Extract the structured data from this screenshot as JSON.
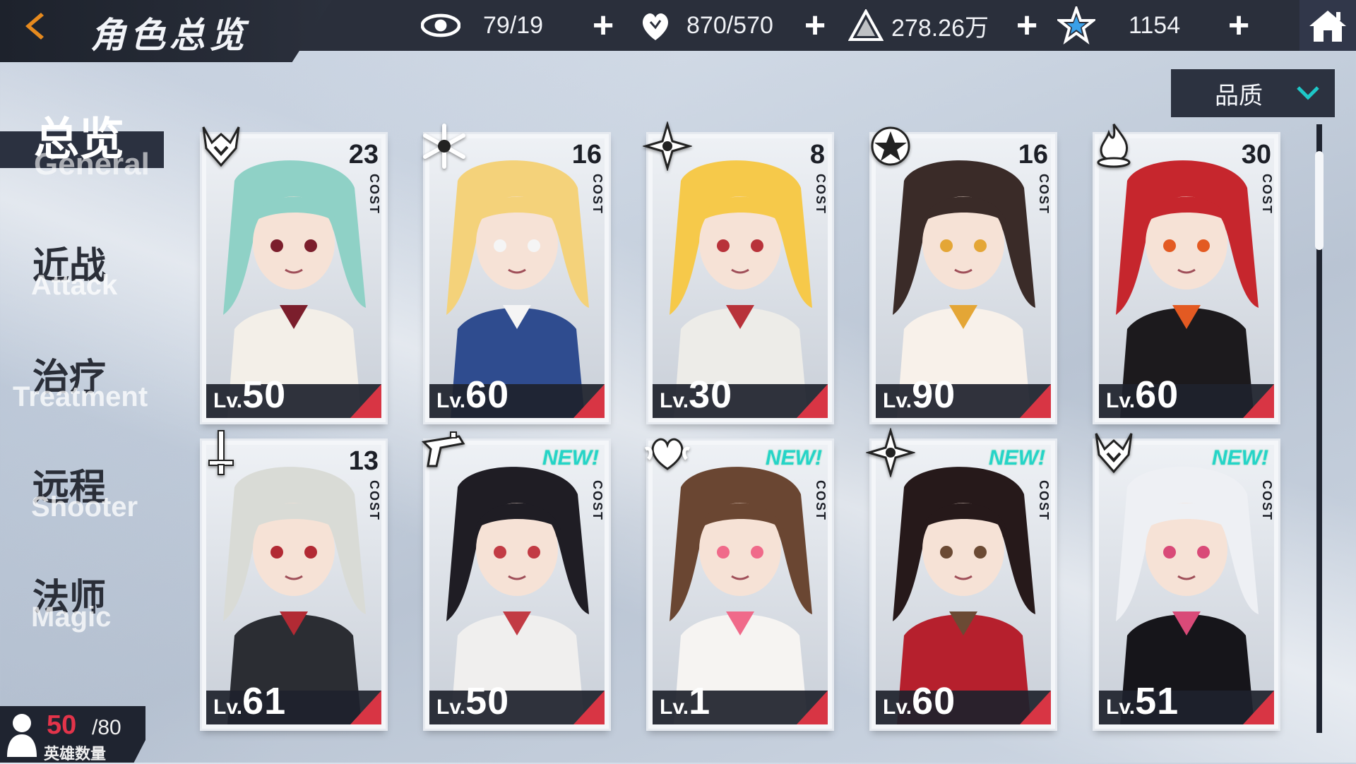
{
  "header": {
    "title": "角色总览",
    "back_icon": "back-arrow-icon",
    "resources": [
      {
        "name": "vision",
        "icon": "eye-icon",
        "value": "79/19"
      },
      {
        "name": "stamina",
        "icon": "heart-icon",
        "value": "870/570"
      },
      {
        "name": "gold",
        "icon": "pyramid-icon",
        "value": "278.26万"
      },
      {
        "name": "gems",
        "icon": "star-icon",
        "value": "1154"
      }
    ],
    "home_icon": "home-icon"
  },
  "sort": {
    "label": "品质"
  },
  "nav": [
    {
      "zh": "总览",
      "en": "General",
      "active": true
    },
    {
      "zh": "近战",
      "en": "Attack",
      "active": false
    },
    {
      "zh": "治疗",
      "en": "Treatment",
      "active": false
    },
    {
      "zh": "远程",
      "en": "Shooter",
      "active": false
    },
    {
      "zh": "法师",
      "en": "Magic",
      "active": false
    }
  ],
  "cards": [
    {
      "lv_prefix": "Lv.",
      "level": "50",
      "cost": "23",
      "cost_label": "COST",
      "new": "",
      "role_icon": "demon-icon",
      "palette": [
        "#8fd1c6",
        "#f3efe8",
        "#7b1e2c"
      ]
    },
    {
      "lv_prefix": "Lv.",
      "level": "60",
      "cost": "16",
      "cost_label": "COST",
      "new": "",
      "role_icon": "snowflake-icon",
      "palette": [
        "#f4d27a",
        "#2f4c8f",
        "#f5f5f5"
      ]
    },
    {
      "lv_prefix": "Lv.",
      "level": "30",
      "cost": "8",
      "cost_label": "COST",
      "new": "",
      "role_icon": "shuriken-icon",
      "palette": [
        "#f6c94a",
        "#edece8",
        "#b8323a"
      ]
    },
    {
      "lv_prefix": "Lv.",
      "level": "90",
      "cost": "16",
      "cost_label": "COST",
      "new": "",
      "role_icon": "crest-icon",
      "palette": [
        "#3a2b28",
        "#f8f1ea",
        "#e4a636"
      ]
    },
    {
      "lv_prefix": "Lv.",
      "level": "60",
      "cost": "30",
      "cost_label": "COST",
      "new": "",
      "role_icon": "flame-icon",
      "palette": [
        "#c6262d",
        "#1c1a1d",
        "#e35a22"
      ]
    },
    {
      "lv_prefix": "Lv.",
      "level": "61",
      "cost": "13",
      "cost_label": "COST",
      "new": "",
      "role_icon": "sword-icon",
      "palette": [
        "#d9dbd6",
        "#2b2d33",
        "#b22a34"
      ]
    },
    {
      "lv_prefix": "Lv.",
      "level": "50",
      "cost": "",
      "cost_label": "COST",
      "new": "NEW!",
      "role_icon": "gun-icon",
      "palette": [
        "#1f1d24",
        "#f0efee",
        "#c23b44"
      ]
    },
    {
      "lv_prefix": "Lv.",
      "level": "1",
      "cost": "",
      "cost_label": "COST",
      "new": "NEW!",
      "role_icon": "heart-wing-icon",
      "palette": [
        "#6a4632",
        "#f6f4f2",
        "#f06a8a"
      ]
    },
    {
      "lv_prefix": "Lv.",
      "level": "60",
      "cost": "",
      "cost_label": "COST",
      "new": "NEW!",
      "role_icon": "shuriken-icon",
      "palette": [
        "#26191a",
        "#b6202d",
        "#6b4a34"
      ]
    },
    {
      "lv_prefix": "Lv.",
      "level": "51",
      "cost": "",
      "cost_label": "COST",
      "new": "NEW!",
      "role_icon": "demon-icon",
      "palette": [
        "#eef0f4",
        "#16151a",
        "#d94a78"
      ]
    }
  ],
  "hero_count": {
    "current": "50",
    "max": "/80",
    "label": "英雄数量"
  }
}
